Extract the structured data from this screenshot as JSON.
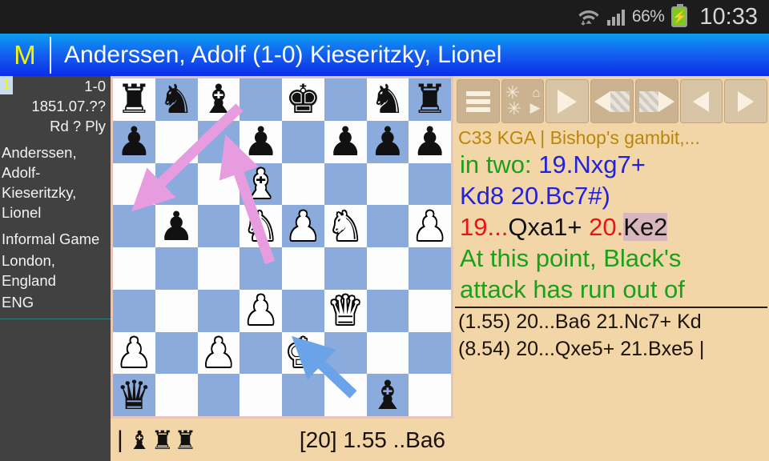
{
  "statusbar": {
    "wifi_icon": "wifi-icon",
    "signal_icon": "signal-bars-icon",
    "battery_percent": "66%",
    "battery_icon": "battery-charging-icon",
    "clock": "10:33"
  },
  "titlebar": {
    "menu_letter": "M",
    "title": "Anderssen, Adolf (1-0) Kieseritzky, Lionel"
  },
  "sidebar": {
    "badge": "1",
    "result": "1-0",
    "date": "1851.07.??",
    "round_ply": "Rd ?  Ply",
    "players": "Anderssen, Adolf-Kieseritzky, Lionel",
    "event": "Informal Game",
    "site": "London, England",
    "country": "ENG"
  },
  "board": {
    "light_color": "#fdfdfd",
    "dark_color": "#8babdd",
    "border_color": "#e7c5b8",
    "arrow_move_color": "#e89ce0",
    "arrow_king_color": "#6ba3e8",
    "ranks": [
      [
        "r",
        "n",
        "b",
        "",
        "k",
        "",
        "n",
        "r"
      ],
      [
        "p",
        "",
        "",
        "p",
        "",
        "p",
        "p",
        "p"
      ],
      [
        "",
        "",
        "",
        "B",
        "",
        "",
        "",
        ""
      ],
      [
        "",
        "p",
        "",
        "N",
        "P",
        "N",
        "",
        "P"
      ],
      [
        "",
        "",
        "",
        "",
        "",
        "",
        "",
        ""
      ],
      [
        "",
        "",
        "",
        "P",
        "",
        "Q",
        "",
        ""
      ],
      [
        "P",
        "",
        "P",
        "",
        "K",
        "",
        "",
        ""
      ],
      [
        "q",
        "",
        "",
        "",
        "",
        "",
        "b",
        ""
      ]
    ],
    "arrows": [
      {
        "name": "bishop-move-arrow",
        "from": "c8",
        "to": "a6",
        "color": "#e89ce0"
      },
      {
        "name": "knight-move-arrow",
        "from": "d5",
        "to": "c6",
        "color": "#e89ce0"
      },
      {
        "name": "king-highlight-arrow",
        "from": "f1",
        "to": "e2",
        "color": "#6ba3e8"
      }
    ]
  },
  "bottomstrip": {
    "separator": "|",
    "captured": "♝♜♜",
    "eval": "[20] 1.55 ..Ba6"
  },
  "toolbar": {
    "buttons": [
      {
        "name": "menu-button",
        "icon": "hamburger-icon"
      },
      {
        "name": "engine-settings-button",
        "icon": "gears-icon"
      },
      {
        "name": "play-button",
        "icon": "play-icon"
      },
      {
        "name": "board-back-button",
        "icon": "board-step-back-icon"
      },
      {
        "name": "board-forward-button",
        "icon": "board-step-forward-icon"
      },
      {
        "name": "prev-move-button",
        "icon": "triangle-left-icon"
      },
      {
        "name": "next-move-button",
        "icon": "triangle-right-icon"
      }
    ]
  },
  "analysis": {
    "eco": "C33 KGA | Bishop's gambit,...",
    "mate_label": "in two:",
    "mate_line1": "19.Nxg7+",
    "mate_line2": "Kd8 20.Bc7#)",
    "move_num_black": "19...",
    "move_black": "Qxa1+",
    "move_num_white": "20.",
    "move_white": "Ke2",
    "comment_line1": "At this point, Black's",
    "comment_line2": "attack has run out of"
  },
  "engine": {
    "lines": [
      "(1.55) 20...Ba6 21.Nc7+ Kd",
      "(8.54) 20...Qxe5+ 21.Bxe5 |"
    ]
  }
}
